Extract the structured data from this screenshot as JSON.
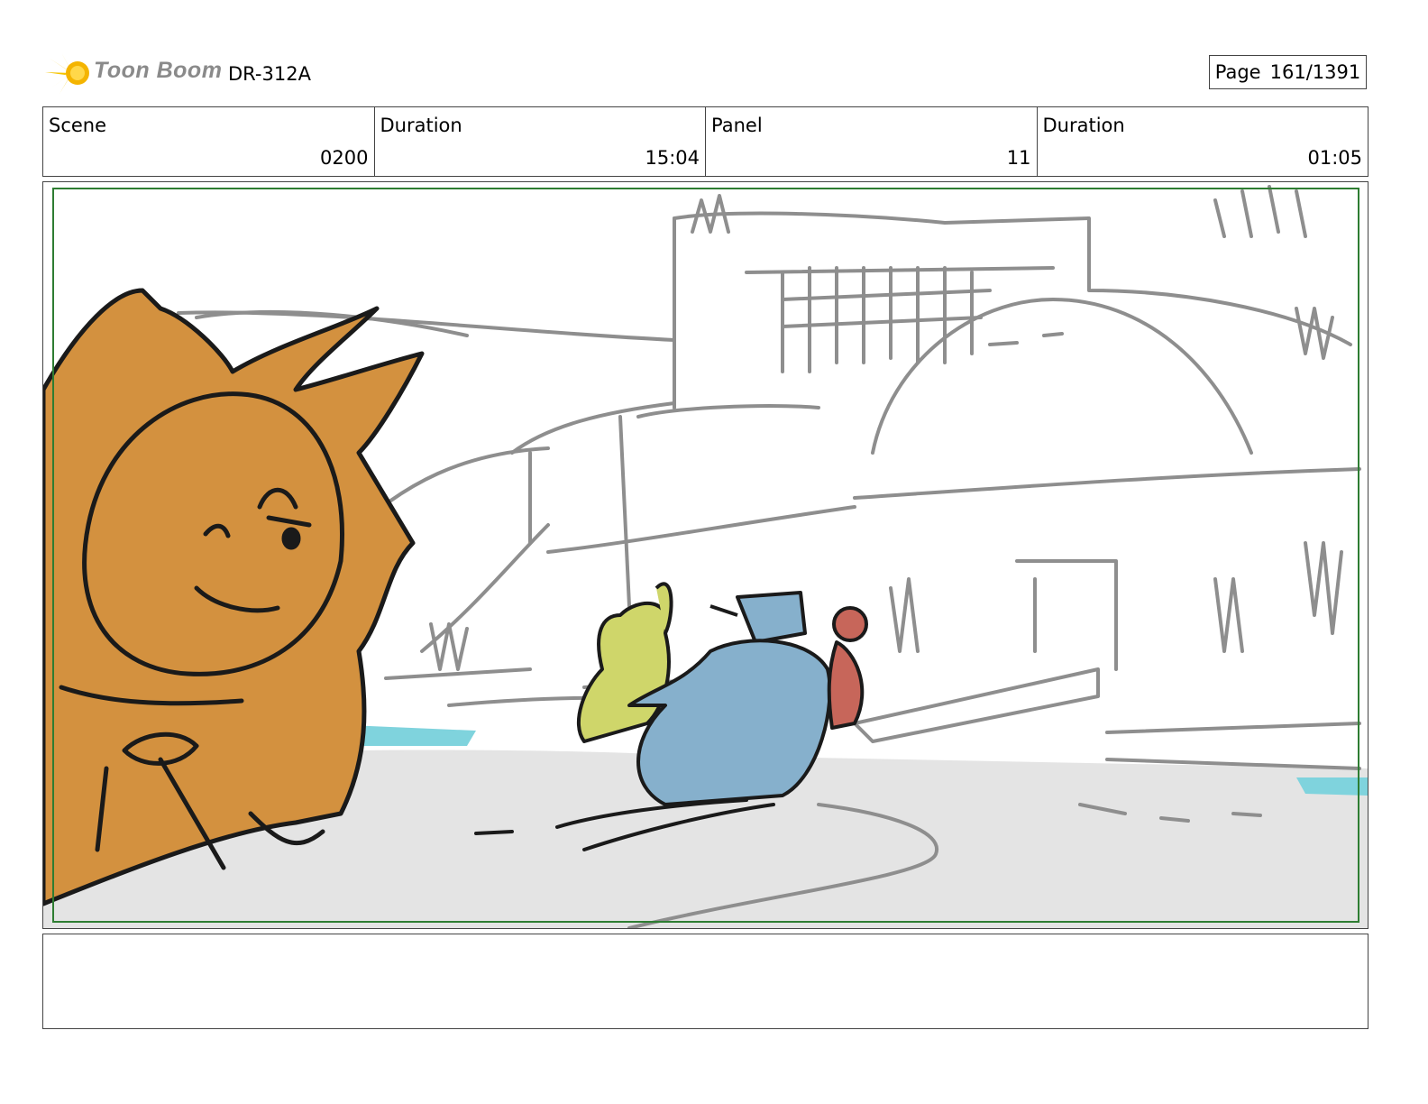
{
  "header": {
    "brand": "Toon Boom",
    "doc_id": "DR-312A",
    "page_label": "Page",
    "page_value": "161/1391"
  },
  "info": [
    {
      "label": "Scene",
      "value": "0200"
    },
    {
      "label": "Duration",
      "value": "15:04"
    },
    {
      "label": "Panel",
      "value": "11"
    },
    {
      "label": "Duration",
      "value": "01:05"
    }
  ],
  "notes": "",
  "colors": {
    "safe_area": "#2e7d32",
    "orange_character": "#d3913f",
    "yellow_character": "#cfd66a",
    "blue_character": "#86b0cc",
    "red_character": "#c7665a",
    "water": "#7fd3dd",
    "ground": "#e4e4e4",
    "sketch_gray": "#8e8e8e"
  }
}
